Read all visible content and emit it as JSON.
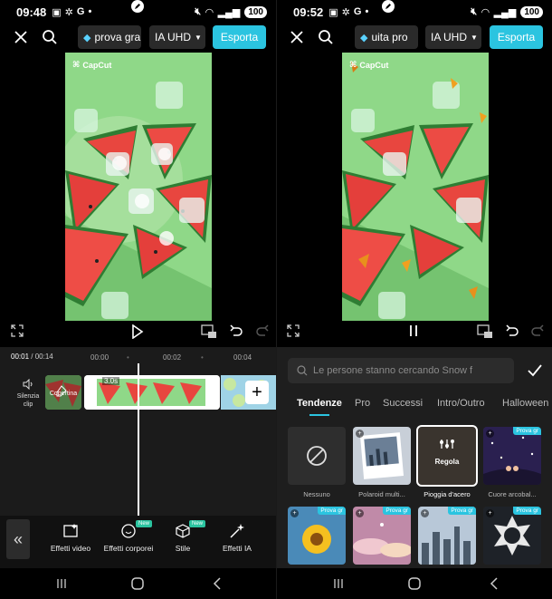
{
  "left": {
    "status": {
      "time": "09:48",
      "battery": "100"
    },
    "topbar": {
      "prova_label": "prova gra",
      "quality_label": "IA UHD",
      "export_label": "Esporta"
    },
    "preview": {
      "logo_text": "CapCut"
    },
    "timeline": {
      "current": "00:01",
      "total": "/ 00:14",
      "ticks": [
        "00:00",
        "00:02",
        "00:04"
      ],
      "mute_label": "Silenzia clip",
      "cover_label": "Copertina",
      "clip_duration": "3.0s"
    },
    "toolbar": {
      "tools": [
        {
          "label": "Effetti video",
          "new": false
        },
        {
          "label": "Effetti corporei",
          "new": true,
          "new_label": "New"
        },
        {
          "label": "Stile",
          "new": true,
          "new_label": "New"
        },
        {
          "label": "Effetti IA",
          "new": false
        }
      ]
    }
  },
  "right": {
    "status": {
      "time": "09:52",
      "battery": "100"
    },
    "topbar": {
      "prova_label": "uita   pro",
      "quality_label": "IA UHD",
      "export_label": "Esporta"
    },
    "preview": {
      "logo_text": "CapCut"
    },
    "panel": {
      "search_placeholder": "Le persone stanno cercando Snow f",
      "tabs": [
        "Tendenze",
        "Pro",
        "Successi",
        "Intro/Outro",
        "Halloween"
      ],
      "active_tab": "Tendenze",
      "effects_row1": [
        {
          "label": "Nessuno"
        },
        {
          "label": "Polaroid multi..."
        },
        {
          "label": "Pioggia d'acero",
          "overlay": "Regola"
        },
        {
          "label": "Cuore arcobal...",
          "badge": "Prova gr"
        }
      ],
      "effects_row2_badges": [
        "Prova gr",
        "Prova gr",
        "Prova gr",
        "Prova gr"
      ]
    }
  },
  "colors": {
    "accent": "#2bc4e0",
    "new_badge": "#2bc4a0",
    "bg_green": "#84d17e"
  }
}
